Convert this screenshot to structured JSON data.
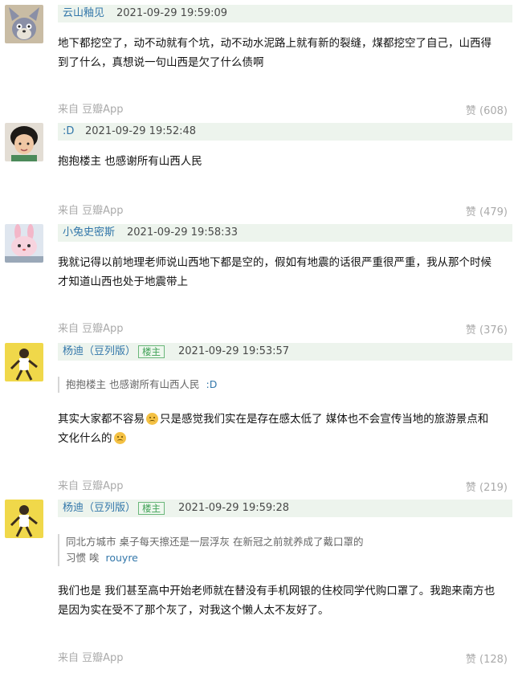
{
  "comments": [
    {
      "user": "云山釉见",
      "time": "2021-09-29 19:59:09",
      "avatar": "tom-cat-avatar",
      "text_lines": [
        "地下都挖空了，动不动就有个坑，动不动水泥路上就有新的裂缝，煤都挖空了自己，山西得",
        "到了什么，真想说一句山西是欠了什么债啊"
      ],
      "source": "来自 豆瓣App",
      "likes": "赞 (608)"
    },
    {
      "user": ":D",
      "time": "2021-09-29 19:52:48",
      "avatar": "girl-photo-avatar",
      "text_lines": [
        "抱抱楼主 也感谢所有山西人民"
      ],
      "source": "来自 豆瓣App",
      "likes": "赞 (479)"
    },
    {
      "user": "小兔史密斯",
      "time": "2021-09-29 19:58:33",
      "avatar": "pink-rabbit-avatar",
      "text_lines": [
        "我就记得以前地理老师说山西地下都是空的，假如有地震的话很严重很严重，我从那个时候",
        "才知道山西也处于地震带上"
      ],
      "source": "来自 豆瓣App",
      "likes": "赞 (376)"
    },
    {
      "user": "杨迪（豆列版）",
      "badge": "楼主",
      "time": "2021-09-29 19:53:57",
      "avatar": "yellow-figure-avatar",
      "quote_lines": [
        "抱抱楼主 也感谢所有山西人民"
      ],
      "quote_author": ":D",
      "text_parts": [
        "其实大家都不容易",
        "只是感觉我们实在是存在感太低了 媒体也不会宣传当地的旅游景点和",
        "文化什么的"
      ],
      "source": "来自 豆瓣App",
      "likes": "赞 (219)"
    },
    {
      "user": "杨迪（豆列版）",
      "badge": "楼主",
      "time": "2021-09-29 19:59:28",
      "avatar": "yellow-figure-avatar",
      "quote_lines": [
        "同北方城市 桌子每天擦还是一层浮灰 在新冠之前就养成了戴口罩的",
        "习惯 唉"
      ],
      "quote_author": "rouyre",
      "text_lines": [
        "我们也是 我们甚至高中开始老师就在替没有手机网银的住校同学代购口罩了。我跑来南方也",
        "是因为实在受不了那个灰了，对我这个懒人太不友好了。"
      ],
      "source": "来自 豆瓣App",
      "likes": "赞 (128)"
    }
  ]
}
